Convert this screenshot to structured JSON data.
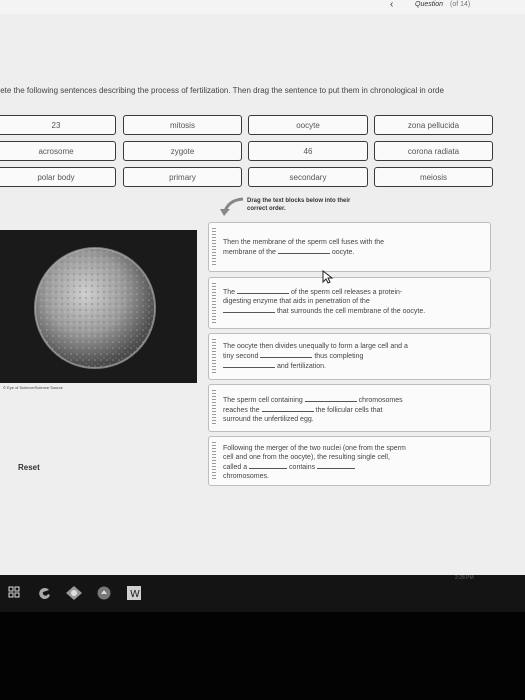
{
  "header": {
    "nav_back": "‹",
    "question_label": "Question",
    "question_count": "(of 14)"
  },
  "instruction": "plete the following sentences describing the process of fertilization. Then drag the sentence to put them in chronological in orde",
  "word_bank": [
    "23",
    "mitosis",
    "oocyte",
    "zona pellucida",
    "acrosome",
    "zygote",
    "46",
    "corona radiata",
    "polar body",
    "primary",
    "secondary",
    "meiosis"
  ],
  "hint": [
    "Drag the text blocks below into their",
    "correct order."
  ],
  "image_credit": "© Eye of Science/Science Source",
  "reset_label": "Reset",
  "sentences": {
    "s1": {
      "a": "Then the membrane of the sperm cell fuses with the",
      "b": "membrane of the",
      "c": "oocyte."
    },
    "s2": {
      "a": "The",
      "b": "of the sperm cell releases a protein-",
      "c": "digesting enzyme that aids in penetration of the",
      "d": "that surrounds the cell membrane of the oocyte."
    },
    "s3": {
      "a": "The oocyte then divides unequally to form a large cell and a",
      "b": "tiny second",
      "c": "thus completing",
      "d": "and fertilization."
    },
    "s4": {
      "a": "The sperm cell containing",
      "b": "chromosomes",
      "c": "reaches the",
      "d": "the follicular cells that",
      "e": "surround the unfertilized egg."
    },
    "s5": {
      "a": "Following the merger of the two nuclei (one from the sperm",
      "b": "cell and one from the oocyte), the resulting single cell,",
      "c": "called a",
      "d": "contains",
      "e": "chromosomes."
    }
  },
  "taskbar": {
    "icons": [
      "task-view-icon",
      "edge-browser-icon",
      "app-diamond-icon",
      "app-circle-icon",
      "word-icon"
    ],
    "clock": "2:28 PM"
  },
  "colors": {
    "accent": "#3a3a3a",
    "card_bg": "#fbfbfb",
    "page_bg": "#eeeeee"
  }
}
